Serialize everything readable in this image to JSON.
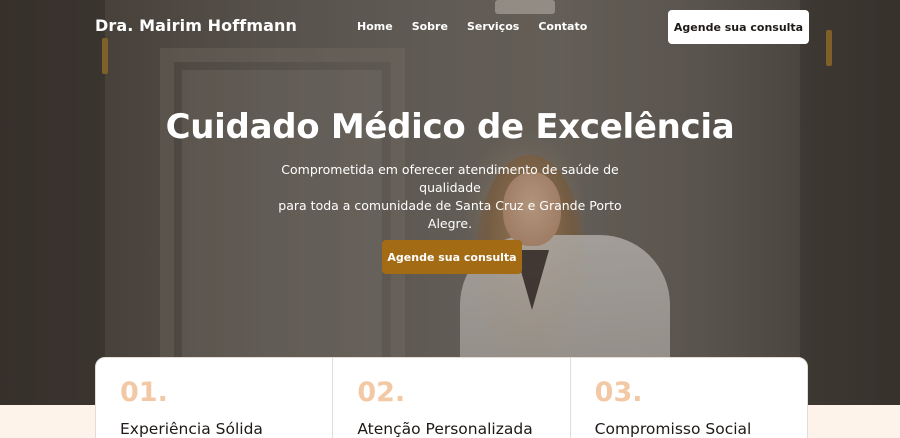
{
  "navbar": {
    "brand": "Dra. Mairim Hoffmann",
    "links": [
      "Home",
      "Sobre",
      "Serviços",
      "Contato"
    ],
    "cta_label": "Agende sua consulta"
  },
  "hero": {
    "title": "Cuidado Médico de Excelência",
    "subtitle_line1": "Comprometida em oferecer atendimento de saúde de qualidade",
    "subtitle_line2": "para toda a comunidade de Santa Cruz e Grande Porto Alegre.",
    "cta_label": "Agende sua consulta"
  },
  "features": [
    {
      "number": "01.",
      "title": "Experiência Sólida"
    },
    {
      "number": "02.",
      "title": "Atenção Personalizada"
    },
    {
      "number": "03.",
      "title": "Compromisso Social"
    }
  ],
  "colors": {
    "accent": "#a26b14",
    "number_tint": "#f3c9a5",
    "page_bg": "#fdf3ea"
  }
}
